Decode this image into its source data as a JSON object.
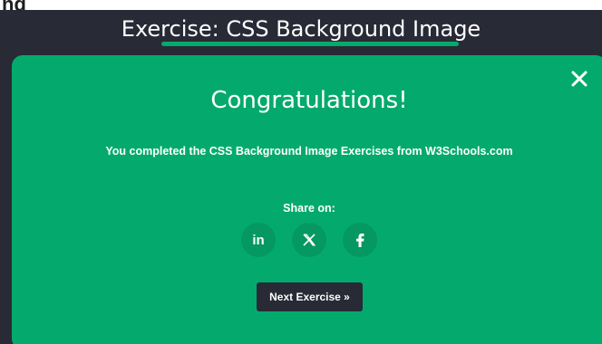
{
  "top_fragment": "ng",
  "header": {
    "title": "Exercise: CSS Background Image",
    "underline_color": "#04aa6d",
    "background_color": "#282a35"
  },
  "modal": {
    "background_color": "#04aa6d",
    "close_icon": "close-icon",
    "title": "Congratulations!",
    "message": "You completed the CSS Background Image Exercises from W3Schools.com",
    "share_label": "Share on:",
    "share_buttons": [
      {
        "icon": "linkedin-icon",
        "label": "in"
      },
      {
        "icon": "x-icon",
        "label": "𝕏"
      },
      {
        "icon": "facebook-icon",
        "label": "f"
      }
    ],
    "next_button_label": "Next Exercise »"
  }
}
